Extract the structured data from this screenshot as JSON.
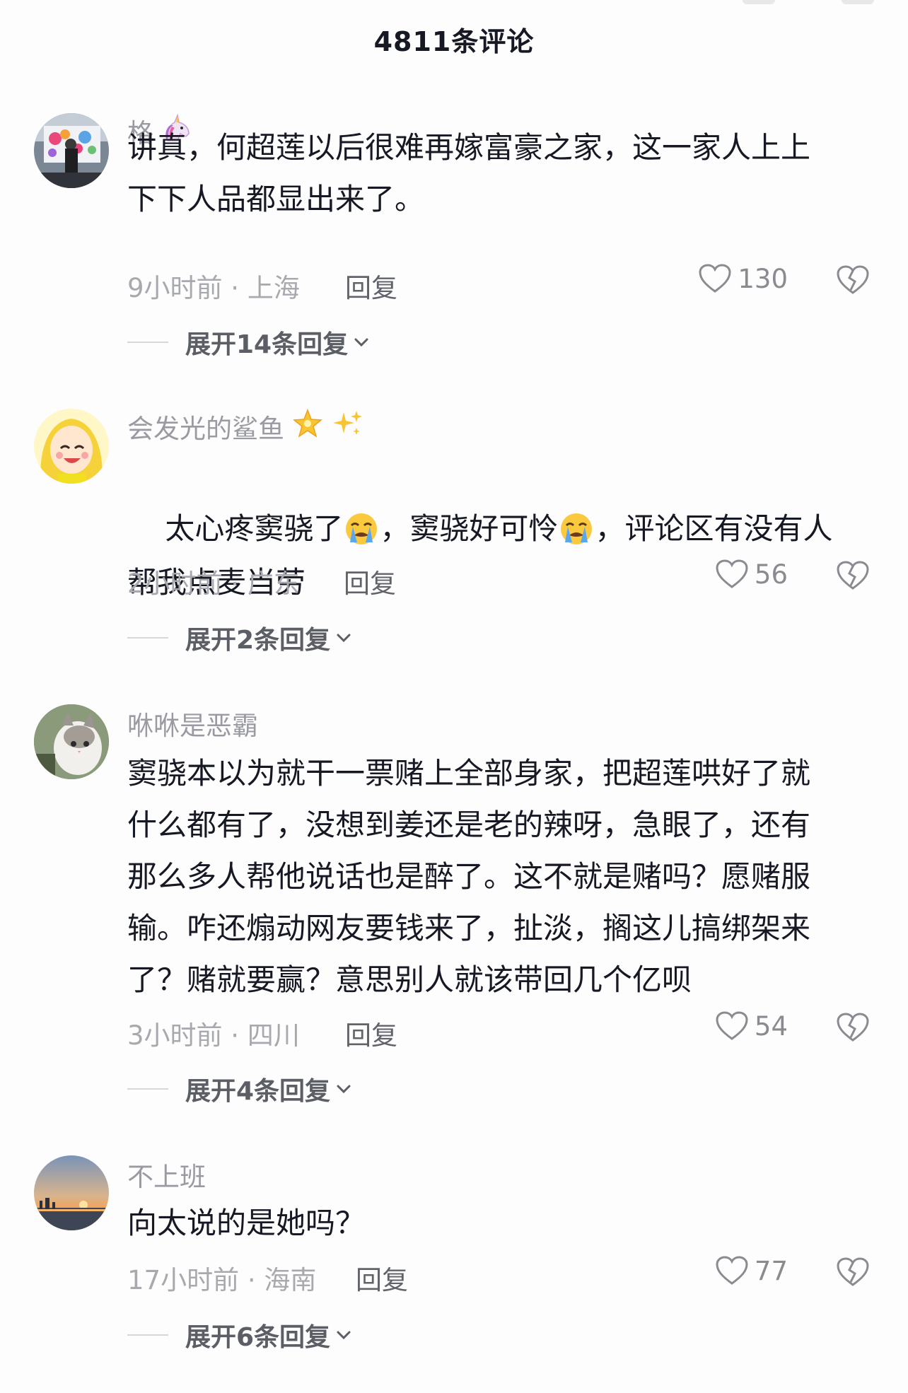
{
  "header": {
    "title": "4811条评论"
  },
  "comments": [
    {
      "username": "格",
      "badge_emoji": "🦄",
      "text": "讲真，何超莲以后很难再嫁富豪之家，这一家人上上\n下下人品都显出来了。",
      "time": "9小时前",
      "location": "上海",
      "meta": "9小时前 · 上海",
      "reply_label": "回复",
      "likes": "130",
      "expand_label": "展开14条回复"
    },
    {
      "username": "会发光的鲨鱼",
      "badge_emoji": "🌟✨",
      "text_parts": [
        "太心疼窦骁了",
        "，窦骁好可怜",
        "，评论区有没有人",
        "帮我点麦当劳"
      ],
      "time": "2小时前",
      "location": "广东",
      "meta": "2小时前 · 广东",
      "reply_label": "回复",
      "likes": "56",
      "expand_label": "展开2条回复"
    },
    {
      "username": "咻咻是恶霸",
      "text": "窦骁本以为就干一票赌上全部身家，把超莲哄好了就\n什么都有了，没想到姜还是老的辣呀，急眼了，还有\n那么多人帮他说话也是醉了。这不就是赌吗？愿赌服\n输。咋还煽动网友要钱来了，扯淡，搁这儿搞绑架来\n了？赌就要赢？意思别人就该带回几个亿呗",
      "time": "3小时前",
      "location": "四川",
      "meta": "3小时前 · 四川",
      "reply_label": "回复",
      "likes": "54",
      "expand_label": "展开4条回复"
    },
    {
      "username": "不上班",
      "text": "向太说的是她吗？",
      "time": "17小时前",
      "location": "海南",
      "meta": "17小时前 · 海南",
      "reply_label": "回复",
      "likes": "77",
      "expand_label": "展开6条回复"
    }
  ],
  "icons": {
    "like": "heart-outline-icon",
    "dislike": "broken-heart-icon",
    "expand": "chevron-down-icon"
  },
  "colors": {
    "text_primary": "#161823",
    "text_secondary": "#a8a9ae",
    "username": "#9a9ba2",
    "reply": "#61636b",
    "background": "#fdfdfd"
  }
}
